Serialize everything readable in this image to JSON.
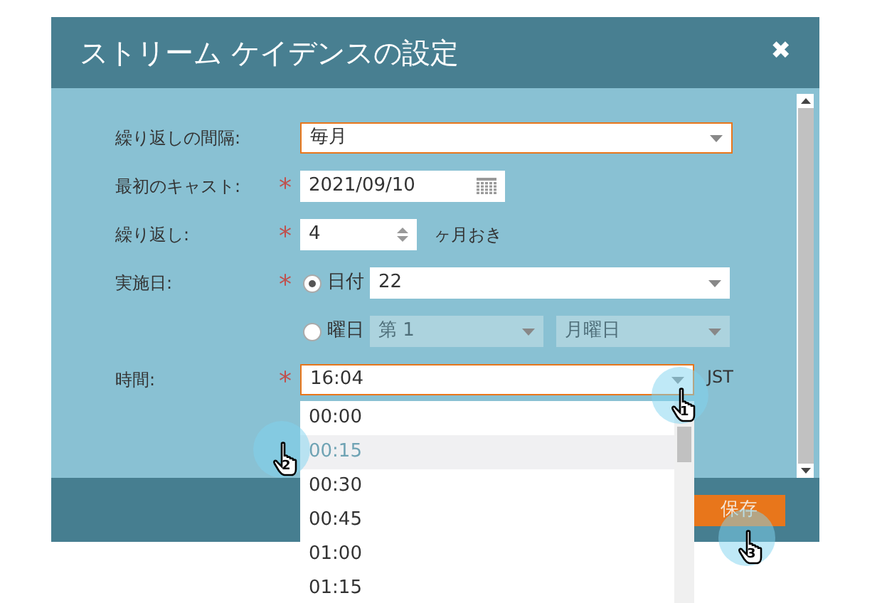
{
  "dialog": {
    "title": "ストリーム ケイデンスの設定",
    "close": "✖",
    "fields": [
      {
        "kind": "select",
        "label": "繰り返しの間隔:",
        "value": "毎月",
        "focused": true
      },
      {
        "kind": "date",
        "label": "最初のキャスト:",
        "required_mark": "*",
        "value": "2021/09/10"
      },
      {
        "kind": "number",
        "label": "繰り返し:",
        "required_mark": "*",
        "value": "4",
        "suffix": "ヶ月おき"
      },
      {
        "kind": "radio",
        "label": "実施日:",
        "required_mark": "*",
        "options": [
          {
            "label": "日付",
            "selected": true,
            "selects": [
              "22"
            ]
          },
          {
            "label": "曜日",
            "selected": false,
            "selects": [
              "第 1",
              "月曜日"
            ]
          }
        ]
      },
      {
        "kind": "time",
        "label": "時間:",
        "required_mark": "*",
        "value": "16:04",
        "suffix": "JST",
        "focused": true
      }
    ],
    "time_options": [
      {
        "label": "00:00",
        "highlighted": false
      },
      {
        "label": "00:15",
        "highlighted": true
      },
      {
        "label": "00:30",
        "highlighted": false
      },
      {
        "label": "00:45",
        "highlighted": false
      },
      {
        "label": "01:00",
        "highlighted": false
      },
      {
        "label": "01:15",
        "highlighted": false
      }
    ],
    "save_button": "保存"
  },
  "callouts": [
    {
      "number": "1"
    },
    {
      "number": "2"
    },
    {
      "number": "3"
    }
  ]
}
